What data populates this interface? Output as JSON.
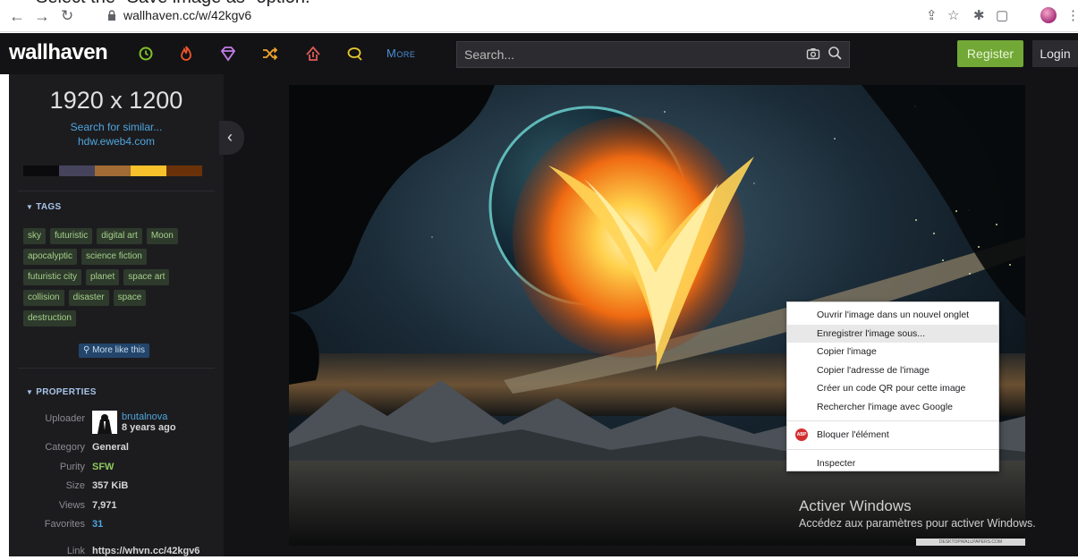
{
  "browser": {
    "caption": "Select the \"Save image as\" option.",
    "url": "wallhaven.cc/w/42kgv6"
  },
  "header": {
    "logo": "wallhaven",
    "more_label": "More",
    "search_placeholder": "Search...",
    "register_label": "Register",
    "login_label": "Login",
    "nav_colors": {
      "latest": "#7fc22a",
      "hot": "#f0562a",
      "toplist": "#c27ce8",
      "random": "#f0a32a",
      "upload": "#e05a58",
      "forums": "#e9c830"
    }
  },
  "sidebar": {
    "resolution": "1920 x 1200",
    "search_similar": "Search for similar...",
    "source": "hdw.eweb4.com",
    "palette": [
      "#0b0b0d",
      "#46445c",
      "#a06b34",
      "#f6c12b",
      "#6a3208"
    ],
    "tags_heading": "TAGS",
    "tags": [
      [
        "sky",
        "futuristic",
        "digital art",
        "Moon"
      ],
      [
        "apocalyptic",
        "science fiction"
      ],
      [
        "futuristic city",
        "planet",
        "space art"
      ],
      [
        "collision",
        "disaster",
        "space"
      ],
      [
        "destruction"
      ]
    ],
    "more_like_this": "More like this",
    "properties_heading": "PROPERTIES",
    "properties": {
      "uploader_key": "Uploader",
      "uploader_name": "brutalnova",
      "uploader_time": "8 years ago",
      "category_key": "Category",
      "category_val": "General",
      "purity_key": "Purity",
      "purity_val": "SFW",
      "purity_color": "#8fc95c",
      "size_key": "Size",
      "size_val": "357 KiB",
      "views_key": "Views",
      "views_val": "7,971",
      "favorites_key": "Favorites",
      "favorites_val": "31",
      "link_key": "Link",
      "link_val": "https://whvn.cc/42kgv6"
    }
  },
  "context_menu": {
    "items": [
      "Ouvrir l'image dans un nouvel onglet",
      "Enregistrer l'image sous...",
      "Copier l'image",
      "Copier l'adresse de l'image",
      "Créer un code QR pour cette image",
      "Rechercher l'image avec Google"
    ],
    "abp_badge": "ABP",
    "block_item": "Bloquer l'élément",
    "inspect_item": "Inspecter"
  },
  "watermark_text": "DESKTOPWALLPAPERS.COM",
  "activation": {
    "title": "Activer Windows",
    "subtitle": "Accédez aux paramètres pour activer Windows."
  }
}
